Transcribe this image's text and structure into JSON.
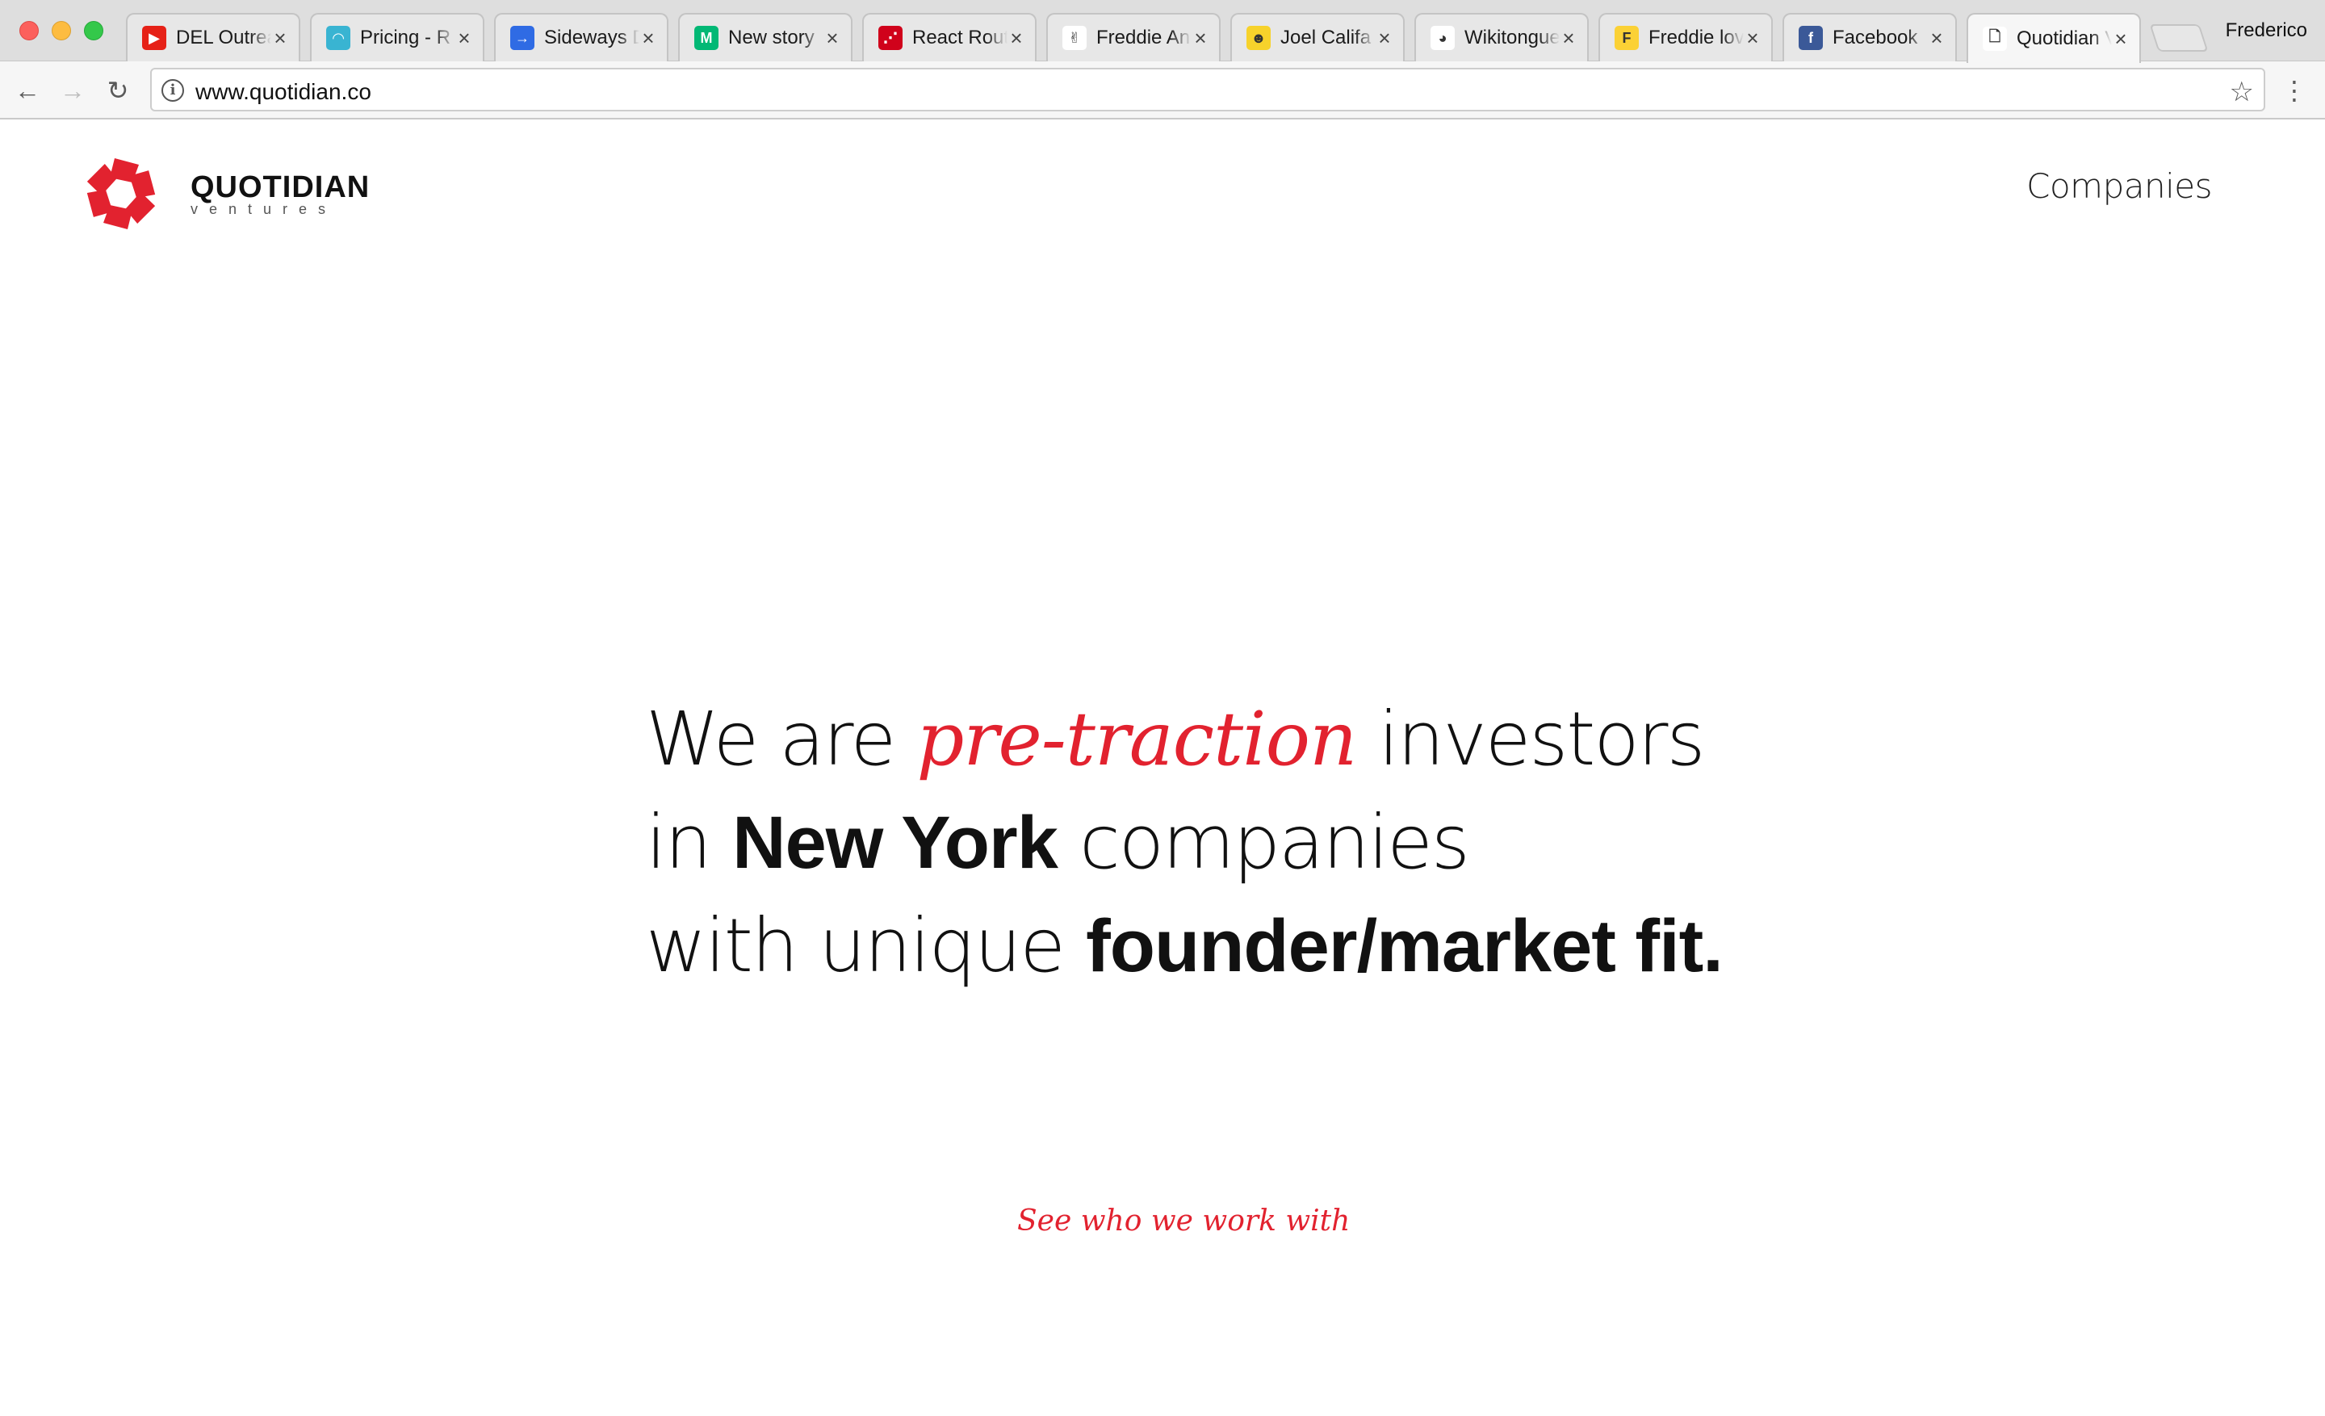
{
  "browser": {
    "tabs": [
      {
        "title": "DEL Outreach",
        "favicon": "youtube-icon",
        "color": "#e62117",
        "glyph": "▶"
      },
      {
        "title": "Pricing - R",
        "favicon": "pricing-icon",
        "color": "#39b4d2",
        "glyph": "◠"
      },
      {
        "title": "Sideways D",
        "favicon": "arrow-circle-icon",
        "color": "#2f6be4",
        "glyph": "→"
      },
      {
        "title": "New story",
        "favicon": "medium-icon",
        "color": "#02b875",
        "glyph": "M"
      },
      {
        "title": "React Router",
        "favicon": "react-router-icon",
        "color": "#d0021b",
        "glyph": "⋰"
      },
      {
        "title": "Freddie An",
        "favicon": "peace-hand-icon",
        "color": "#ffffff",
        "glyph": "✌"
      },
      {
        "title": "Joel Califa",
        "favicon": "emoji-face-icon",
        "color": "#f7d22b",
        "glyph": "☻"
      },
      {
        "title": "Wikitongues",
        "favicon": "panda-icon",
        "color": "#ffffff",
        "glyph": "◕"
      },
      {
        "title": "Freddie lov",
        "favicon": "f-letter-icon",
        "color": "#fbd135",
        "glyph": "F"
      },
      {
        "title": "Facebook",
        "favicon": "facebook-icon",
        "color": "#3b5998",
        "glyph": "f"
      },
      {
        "title": "Quotidian V",
        "favicon": "document-icon",
        "color": "#ffffff",
        "glyph": "🗋"
      }
    ],
    "profile": "Frederico",
    "url": "www.quotidian.co"
  },
  "site": {
    "brand_name": "QUOTIDIAN",
    "brand_sub": "ventures",
    "brand_color": "#e2222f",
    "nav_companies": "Companies",
    "hero": {
      "l1_a": "We are ",
      "l1_accent": "pre-traction",
      "l1_b": " investors",
      "l2_a": "in ",
      "l2_bold": "New York",
      "l2_b": " companies",
      "l3_a": "with unique ",
      "l3_bold": "founder/market fit."
    },
    "cta": "See who we work with"
  }
}
